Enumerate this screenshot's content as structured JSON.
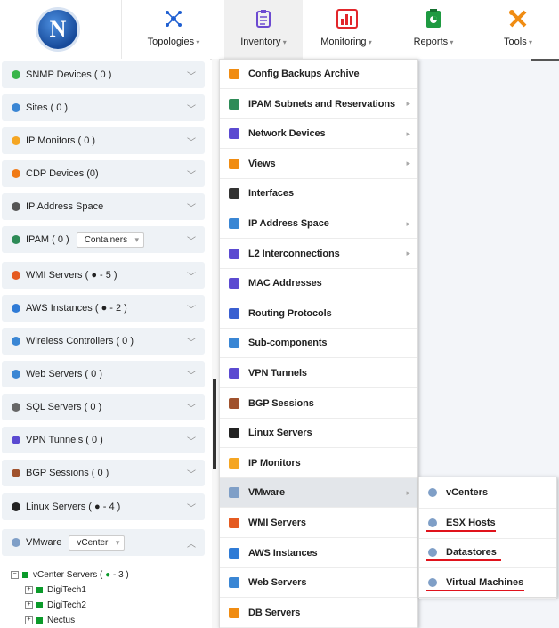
{
  "nav": {
    "items": [
      {
        "label": "Topologies",
        "icon": "topology-icon",
        "color": "#1f5fd1"
      },
      {
        "label": "Inventory",
        "icon": "clipboard-icon",
        "color": "#6c4ad1"
      },
      {
        "label": "Monitoring",
        "icon": "bar-chart-icon",
        "color": "#e2262b"
      },
      {
        "label": "Reports",
        "icon": "report-icon",
        "color": "#1e9a41"
      },
      {
        "label": "Tools",
        "icon": "tools-icon",
        "color": "#f08c12"
      }
    ]
  },
  "sidebar": {
    "items": [
      {
        "label": "SNMP Devices ( 0 )",
        "icon": "check-circle-icon",
        "color": "#39b54a"
      },
      {
        "label": "Sites ( 0 )",
        "icon": "globe-icon",
        "color": "#3a86d4"
      },
      {
        "label": "IP Monitors ( 0 )",
        "icon": "bulb-icon",
        "color": "#f5a623"
      },
      {
        "label": "CDP Devices (0)",
        "icon": "cdp-icon",
        "color": "#f07a16"
      },
      {
        "label": "IP Address Space",
        "icon": "network-globe-icon",
        "color": "#555"
      },
      {
        "label": "IPAM ( 0 )",
        "icon": "ipam-icon",
        "color": "#2e8b57"
      },
      {
        "label": "WMI Servers ( ● - 5 )",
        "icon": "windows-icon",
        "color": "#e55b21"
      },
      {
        "label": "AWS Instances ( ● - 2 )",
        "icon": "cloud-icon",
        "color": "#2f7bd6"
      },
      {
        "label": "Wireless Controllers ( 0 )",
        "icon": "wifi-icon",
        "color": "#3a86d4"
      },
      {
        "label": "Web Servers ( 0 )",
        "icon": "web-icon",
        "color": "#3a86d4"
      },
      {
        "label": "SQL Servers ( 0 )",
        "icon": "database-icon",
        "color": "#666"
      },
      {
        "label": "VPN Tunnels ( 0 )",
        "icon": "vpn-icon",
        "color": "#5b4ad1"
      },
      {
        "label": "BGP Sessions ( 0 )",
        "icon": "bgp-icon",
        "color": "#a0522d"
      },
      {
        "label": "Linux Servers ( ● - 4 )",
        "icon": "linux-icon",
        "color": "#222"
      },
      {
        "label": "VMware",
        "icon": "vmware-icon",
        "color": "#7f9fc7"
      }
    ],
    "ipam_select": "Containers",
    "vmware_select": "vCenter",
    "tree": {
      "root": "vCenter Servers (",
      "root_count": "- 3 )",
      "children": [
        "DigiTech1",
        "DigiTech2",
        "Nectus"
      ]
    }
  },
  "menu": {
    "items": [
      {
        "label": "Config Backups Archive",
        "icon": "refresh-icon",
        "color": "#f08c12",
        "arrow": false
      },
      {
        "label": "IPAM Subnets and Reservations",
        "icon": "ipam-icon",
        "color": "#2e8b57",
        "arrow": true
      },
      {
        "label": "Network Devices",
        "icon": "device-icon",
        "color": "#5b4ad1",
        "arrow": true
      },
      {
        "label": "Views",
        "icon": "search-icon",
        "color": "#f08c12",
        "arrow": true
      },
      {
        "label": "Interfaces",
        "icon": "interface-icon",
        "color": "#333",
        "arrow": false
      },
      {
        "label": "IP Address Space",
        "icon": "ip-space-icon",
        "color": "#3a86d4",
        "arrow": true
      },
      {
        "label": "L2 Interconnections",
        "icon": "l2-icon",
        "color": "#5b4ad1",
        "arrow": true
      },
      {
        "label": "MAC Addresses",
        "icon": "mac-icon",
        "color": "#5b4ad1",
        "arrow": false
      },
      {
        "label": "Routing Protocols",
        "icon": "routing-icon",
        "color": "#3a5fd1",
        "arrow": false
      },
      {
        "label": "Sub-components",
        "icon": "subcomponent-icon",
        "color": "#3a86d4",
        "arrow": false
      },
      {
        "label": "VPN Tunnels",
        "icon": "vpn-icon",
        "color": "#5b4ad1",
        "arrow": false
      },
      {
        "label": "BGP Sessions",
        "icon": "bgp-icon",
        "color": "#a0522d",
        "arrow": false
      },
      {
        "label": "Linux Servers",
        "icon": "linux-icon",
        "color": "#222",
        "arrow": false
      },
      {
        "label": "IP Monitors",
        "icon": "bulb-icon",
        "color": "#f5a623",
        "arrow": false
      },
      {
        "label": "VMware",
        "icon": "vmware-icon",
        "color": "#7f9fc7",
        "arrow": true
      },
      {
        "label": "WMI Servers",
        "icon": "windows-icon",
        "color": "#e55b21",
        "arrow": false
      },
      {
        "label": "AWS Instances",
        "icon": "cloud-icon",
        "color": "#2f7bd6",
        "arrow": false
      },
      {
        "label": "Web Servers",
        "icon": "web-icon",
        "color": "#3a86d4",
        "arrow": false
      },
      {
        "label": "DB Servers",
        "icon": "database-icon",
        "color": "#f08c12",
        "arrow": false
      }
    ]
  },
  "submenu": {
    "items": [
      {
        "label": "vCenters",
        "underlined": false
      },
      {
        "label": "ESX Hosts",
        "underlined": true
      },
      {
        "label": "Datastores",
        "underlined": true
      },
      {
        "label": "Virtual Machines",
        "underlined": true
      }
    ]
  },
  "colors": {
    "highlight_underline": "#e0131c",
    "status_green": "#0b9a2a"
  }
}
